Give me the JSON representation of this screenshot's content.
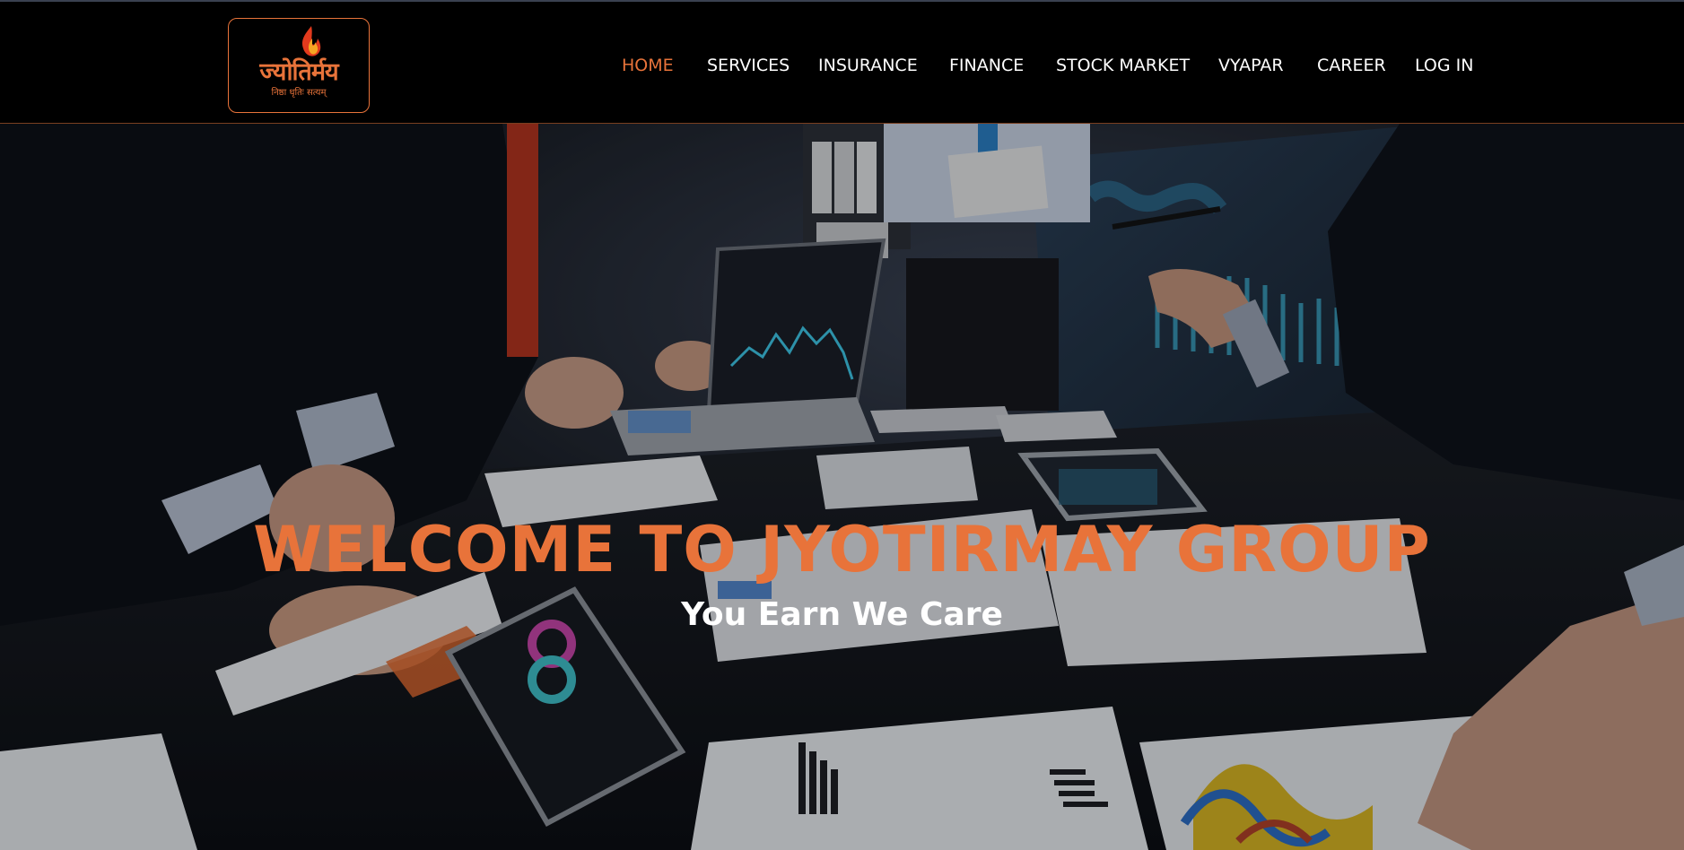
{
  "brand": {
    "logo_text": "ज्योतिर्मय",
    "logo_tagline": "निष्ठा धृतिः सत्यम्",
    "accent_color": "#e8733a",
    "border_color": "#e8733a"
  },
  "nav": {
    "items": [
      {
        "label": "HOME",
        "active": true
      },
      {
        "label": "SERVICES",
        "active": false
      },
      {
        "label": "INSURANCE",
        "active": false
      },
      {
        "label": "FINANCE",
        "active": false
      },
      {
        "label": "STOCK MARKET",
        "active": false
      },
      {
        "label": "VYAPAR",
        "active": false
      },
      {
        "label": "CAREER",
        "active": false
      },
      {
        "label": "LOG IN",
        "active": false
      }
    ],
    "active_color": "#e8733a",
    "text_color": "#ffffff"
  },
  "hero": {
    "title": "WELCOME TO JYOTIRMAY GROUP",
    "subtitle": "You Earn We Care",
    "title_color": "#e8733a",
    "subtitle_color": "#ffffff",
    "background_image": "business-meeting-with-charts-and-laptops"
  },
  "icons": {
    "logo_flame": "flame-icon"
  }
}
